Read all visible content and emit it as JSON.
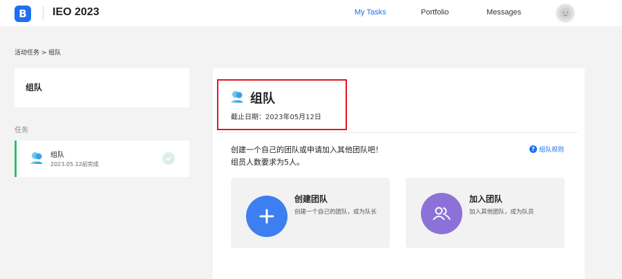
{
  "header": {
    "logo_letter": "B",
    "app_title": "IEO 2023",
    "nav": [
      {
        "label": "My Tasks",
        "active": true
      },
      {
        "label": "Portfolio",
        "active": false
      },
      {
        "label": "Messages",
        "active": false
      }
    ]
  },
  "breadcrumb": "活动任务 > 组队",
  "sidebar": {
    "header_title": "组队",
    "section_label": "任务",
    "tasks": [
      {
        "name": "组队",
        "date": "2023.05.12前完成",
        "completed": true,
        "icon": "team-icon"
      }
    ]
  },
  "main": {
    "title": "组队",
    "deadline": "截止日期：2023年05月12日",
    "description_line1": "创建一个自己的团队或申请加入其他团队吧！",
    "description_line2": "组员人数要求为5人。",
    "rules_link": "组队规则",
    "cards": [
      {
        "title": "创建团队",
        "description": "创建一个自己的团队，成为队长",
        "icon": "plus-icon",
        "color": "#3d7ef0"
      },
      {
        "title": "加入团队",
        "description": "加入其他团队，成为队员",
        "icon": "people-icon",
        "color": "#8c72d8"
      }
    ]
  },
  "colors": {
    "accent": "#1f6ff0",
    "highlight_border": "#e0141b",
    "active_task_bar": "#2fbf71"
  }
}
